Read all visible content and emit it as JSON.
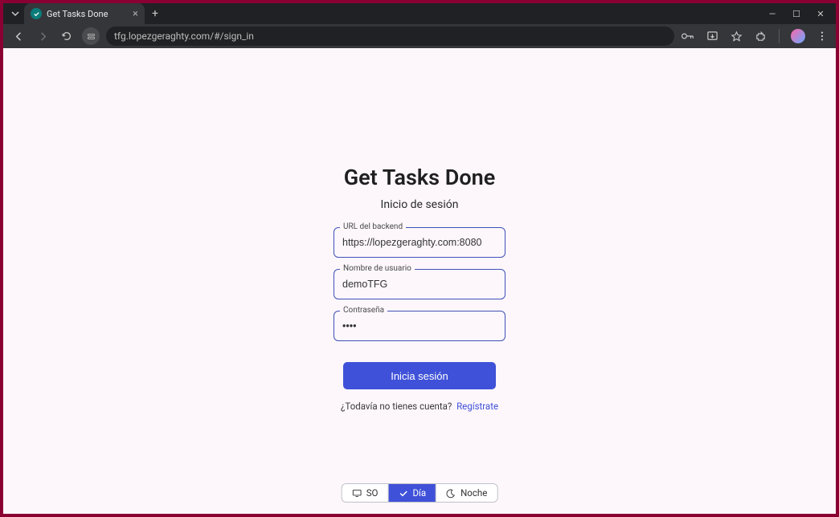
{
  "browser": {
    "tab_title": "Get Tasks Done",
    "url": "tfg.lopezgeraghty.com/#/sign_in"
  },
  "app_title": "Get Tasks Done",
  "subtitle": "Inicio de sesión",
  "fields": {
    "backend": {
      "label": "URL del backend",
      "value": "https://lopezgeraghty.com:8080"
    },
    "username": {
      "label": "Nombre de usuario",
      "value": "demoTFG"
    },
    "password": {
      "label": "Contraseña",
      "value": "••••"
    }
  },
  "submit_label": "Inicia sesión",
  "signup_prompt": "¿Todavía no tienes cuenta?",
  "signup_link": "Regístrate",
  "theme": {
    "so": "SO",
    "dia": "Día",
    "noche": "Noche"
  }
}
